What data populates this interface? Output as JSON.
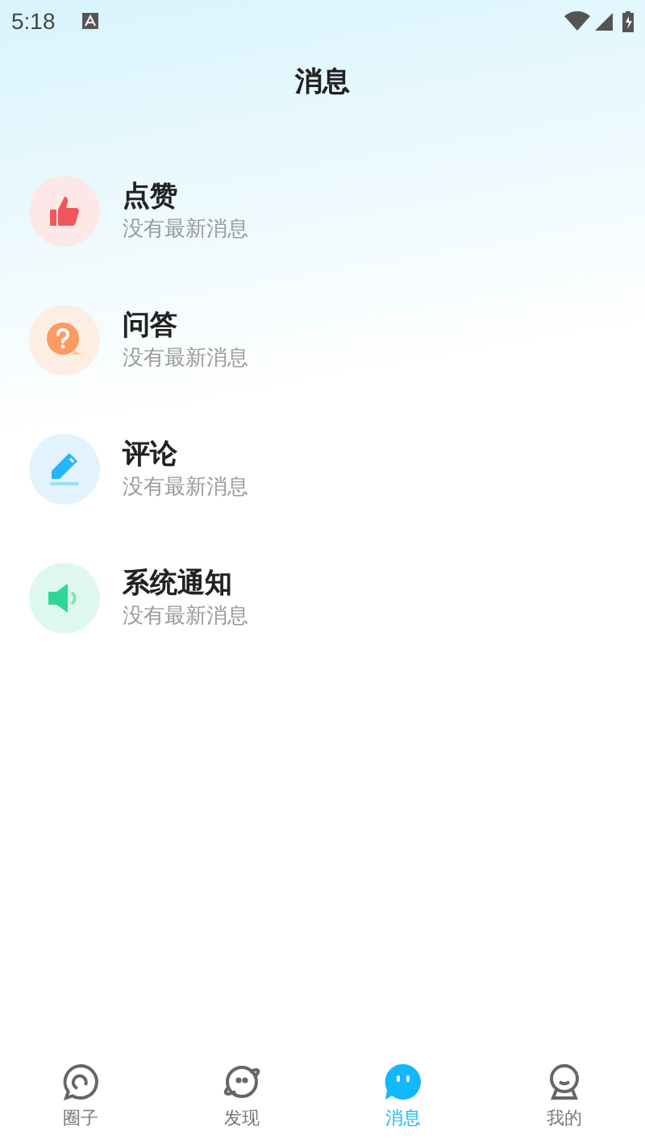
{
  "status_bar": {
    "time": "5:18"
  },
  "title": "消息",
  "items": [
    {
      "kind": "like",
      "title": "点赞",
      "subtitle": "没有最新消息"
    },
    {
      "kind": "qa",
      "title": "问答",
      "subtitle": "没有最新消息"
    },
    {
      "kind": "comment",
      "title": "评论",
      "subtitle": "没有最新消息"
    },
    {
      "kind": "notice",
      "title": "系统通知",
      "subtitle": "没有最新消息"
    }
  ],
  "tabs": [
    {
      "kind": "circle",
      "label": "圈子",
      "selected": false
    },
    {
      "kind": "discover",
      "label": "发现",
      "selected": false
    },
    {
      "kind": "message",
      "label": "消息",
      "selected": true
    },
    {
      "kind": "me",
      "label": "我的",
      "selected": false
    }
  ]
}
